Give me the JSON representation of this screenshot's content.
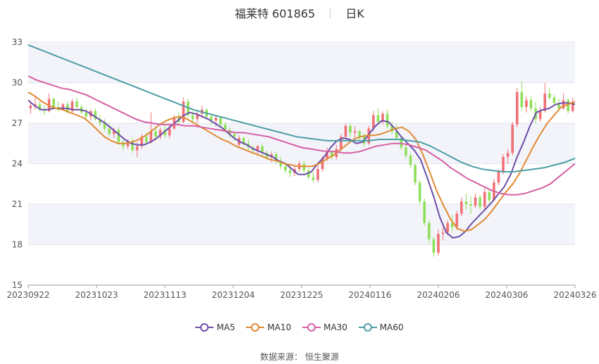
{
  "title": "福莱特 601865",
  "period": "日K",
  "source": "数据来源：   恒生聚源",
  "chart_data": {
    "type": "candlestick",
    "ylim": [
      15,
      33
    ],
    "yticks": [
      15,
      18,
      21,
      24,
      27,
      30,
      33
    ],
    "xticks": [
      "20230922",
      "20231023",
      "20231113",
      "20231204",
      "20231225",
      "20240116",
      "20240206",
      "20240306",
      "20240326"
    ],
    "up_color": "#f07178",
    "down_color": "#8fe05a",
    "candles_ohlc": [
      [
        28.1,
        28.5,
        27.7,
        28.3
      ],
      [
        28.3,
        28.9,
        28.0,
        28.4
      ],
      [
        28.4,
        28.6,
        27.9,
        28.0
      ],
      [
        28.0,
        28.3,
        27.6,
        27.9
      ],
      [
        27.9,
        29.2,
        27.8,
        28.8
      ],
      [
        28.8,
        28.9,
        28.1,
        28.2
      ],
      [
        28.2,
        28.6,
        27.8,
        28.0
      ],
      [
        28.0,
        28.5,
        27.9,
        28.4
      ],
      [
        28.4,
        28.6,
        27.7,
        27.9
      ],
      [
        27.9,
        28.8,
        27.8,
        28.6
      ],
      [
        28.6,
        28.9,
        28.1,
        28.2
      ],
      [
        28.2,
        28.4,
        27.7,
        27.8
      ],
      [
        27.8,
        28.1,
        27.3,
        27.5
      ],
      [
        27.5,
        28.0,
        27.2,
        27.9
      ],
      [
        27.9,
        28.1,
        27.2,
        27.3
      ],
      [
        27.3,
        27.6,
        26.8,
        27.0
      ],
      [
        27.0,
        27.3,
        26.4,
        26.6
      ],
      [
        26.6,
        26.9,
        26.0,
        26.2
      ],
      [
        26.2,
        26.7,
        25.9,
        26.5
      ],
      [
        26.5,
        26.7,
        25.4,
        25.6
      ],
      [
        25.6,
        25.8,
        25.0,
        25.3
      ],
      [
        25.3,
        25.8,
        25.1,
        25.7
      ],
      [
        25.7,
        25.9,
        24.8,
        25.0
      ],
      [
        25.0,
        25.6,
        24.5,
        25.3
      ],
      [
        25.3,
        26.2,
        25.1,
        26.0
      ],
      [
        26.0,
        26.3,
        25.4,
        25.6
      ],
      [
        25.6,
        27.8,
        25.5,
        26.4
      ],
      [
        26.4,
        26.6,
        25.7,
        26.0
      ],
      [
        26.0,
        26.7,
        25.8,
        26.5
      ],
      [
        26.5,
        26.9,
        25.9,
        26.1
      ],
      [
        26.1,
        26.9,
        25.9,
        26.6
      ],
      [
        26.6,
        27.6,
        26.5,
        27.4
      ],
      [
        27.4,
        27.8,
        26.9,
        27.1
      ],
      [
        27.1,
        28.9,
        27.0,
        28.6
      ],
      [
        28.6,
        28.8,
        27.4,
        27.6
      ],
      [
        27.6,
        27.9,
        27.1,
        27.3
      ],
      [
        27.3,
        27.9,
        27.0,
        27.7
      ],
      [
        27.7,
        28.3,
        27.4,
        28.0
      ],
      [
        28.0,
        28.1,
        27.3,
        27.5
      ],
      [
        27.5,
        27.7,
        26.9,
        27.2
      ],
      [
        27.2,
        27.6,
        26.8,
        27.4
      ],
      [
        27.4,
        27.5,
        26.7,
        26.9
      ],
      [
        26.9,
        27.1,
        26.3,
        26.5
      ],
      [
        26.5,
        26.7,
        25.9,
        26.2
      ],
      [
        26.2,
        26.4,
        25.7,
        26.0
      ],
      [
        25.4,
        26.1,
        25.2,
        25.9
      ],
      [
        25.9,
        26.0,
        25.3,
        25.5
      ],
      [
        25.5,
        25.8,
        24.9,
        25.2
      ],
      [
        25.2,
        25.4,
        24.7,
        25.0
      ],
      [
        25.0,
        25.4,
        24.6,
        25.3
      ],
      [
        25.3,
        25.5,
        24.6,
        24.8
      ],
      [
        24.8,
        25.0,
        24.3,
        24.5
      ],
      [
        24.5,
        24.9,
        24.1,
        24.7
      ],
      [
        24.7,
        24.9,
        24.0,
        24.2
      ],
      [
        24.2,
        24.5,
        23.6,
        23.8
      ],
      [
        23.8,
        24.1,
        23.3,
        23.5
      ],
      [
        23.5,
        23.9,
        23.0,
        23.3
      ],
      [
        23.3,
        23.8,
        23.1,
        23.6
      ],
      [
        23.6,
        24.2,
        23.4,
        24.0
      ],
      [
        24.0,
        24.2,
        23.3,
        23.5
      ],
      [
        23.5,
        23.7,
        22.8,
        23.0
      ],
      [
        23.0,
        23.4,
        22.6,
        22.8
      ],
      [
        22.8,
        23.9,
        22.6,
        23.6
      ],
      [
        23.6,
        24.6,
        23.4,
        24.4
      ],
      [
        24.4,
        25.2,
        24.2,
        24.9
      ],
      [
        24.9,
        25.0,
        24.3,
        24.5
      ],
      [
        24.5,
        25.4,
        24.3,
        25.1
      ],
      [
        25.1,
        26.2,
        24.9,
        26.0
      ],
      [
        26.0,
        27.0,
        25.8,
        26.8
      ],
      [
        26.8,
        27.0,
        26.0,
        26.3
      ],
      [
        26.3,
        26.8,
        25.8,
        26.4
      ],
      [
        26.4,
        26.5,
        25.7,
        26.0
      ],
      [
        26.0,
        26.3,
        25.3,
        25.5
      ],
      [
        25.5,
        26.8,
        25.4,
        26.6
      ],
      [
        26.6,
        27.9,
        26.4,
        27.6
      ],
      [
        27.6,
        28.1,
        26.9,
        27.1
      ],
      [
        27.1,
        27.9,
        26.9,
        27.7
      ],
      [
        27.7,
        28.0,
        26.6,
        26.8
      ],
      [
        26.8,
        27.1,
        26.2,
        26.4
      ],
      [
        26.4,
        26.9,
        25.7,
        25.9
      ],
      [
        25.9,
        26.0,
        25.0,
        25.2
      ],
      [
        25.2,
        25.4,
        24.4,
        24.6
      ],
      [
        24.6,
        24.8,
        23.7,
        23.9
      ],
      [
        23.9,
        24.0,
        22.4,
        22.6
      ],
      [
        22.6,
        22.8,
        21.0,
        21.2
      ],
      [
        21.2,
        21.4,
        19.4,
        19.6
      ],
      [
        19.6,
        19.8,
        18.1,
        18.4
      ],
      [
        18.4,
        18.6,
        17.1,
        17.4
      ],
      [
        17.4,
        19.1,
        17.2,
        18.8
      ],
      [
        18.8,
        19.3,
        18.3,
        18.9
      ],
      [
        18.9,
        19.8,
        18.7,
        19.6
      ],
      [
        19.6,
        20.2,
        19.0,
        19.3
      ],
      [
        19.3,
        20.5,
        19.1,
        20.3
      ],
      [
        20.3,
        21.5,
        20.1,
        21.2
      ],
      [
        21.2,
        21.8,
        20.6,
        21.0
      ],
      [
        21.0,
        21.6,
        20.3,
        20.9
      ],
      [
        20.9,
        21.8,
        20.7,
        21.5
      ],
      [
        21.5,
        21.7,
        20.6,
        20.8
      ],
      [
        20.8,
        22.2,
        20.6,
        21.9
      ],
      [
        21.9,
        22.1,
        21.0,
        21.3
      ],
      [
        21.3,
        22.9,
        21.2,
        22.6
      ],
      [
        22.6,
        23.6,
        22.4,
        23.4
      ],
      [
        23.4,
        24.7,
        23.2,
        24.5
      ],
      [
        24.5,
        25.1,
        24.0,
        24.8
      ],
      [
        24.8,
        27.1,
        24.6,
        26.9
      ],
      [
        26.9,
        29.6,
        26.7,
        29.3
      ],
      [
        29.3,
        30.1,
        28.0,
        28.2
      ],
      [
        28.2,
        29.0,
        27.8,
        28.7
      ],
      [
        28.7,
        29.0,
        27.9,
        28.1
      ],
      [
        28.1,
        28.6,
        27.0,
        27.3
      ],
      [
        27.3,
        28.2,
        27.1,
        27.9
      ],
      [
        27.9,
        30.0,
        27.8,
        29.2
      ],
      [
        29.2,
        29.6,
        28.7,
        28.9
      ],
      [
        28.9,
        29.1,
        28.3,
        28.5
      ],
      [
        28.5,
        28.8,
        27.9,
        28.1
      ],
      [
        28.1,
        29.2,
        28.0,
        28.7
      ],
      [
        28.7,
        28.9,
        27.7,
        27.9
      ],
      [
        27.9,
        28.9,
        27.8,
        28.6
      ]
    ],
    "series": [
      {
        "name": "MA5",
        "color": "#6d4fa8",
        "values": [
          28.7,
          28.3,
          28.0,
          28.0,
          28.1,
          28.1,
          28.1,
          28.0,
          28.0,
          27.9,
          27.6,
          27.3,
          27.0,
          26.6,
          26.2,
          25.8,
          25.5,
          25.4,
          25.4,
          25.6,
          25.9,
          26.3,
          26.7,
          27.1,
          27.5,
          27.8,
          27.7,
          27.5,
          27.3,
          27.0,
          26.7,
          26.3,
          25.9,
          25.6,
          25.4,
          25.1,
          24.9,
          24.7,
          24.5,
          24.2,
          24.0,
          23.6,
          23.2,
          23.2,
          23.4,
          24.0,
          24.5,
          25.2,
          25.7,
          25.9,
          25.8,
          25.5,
          25.6,
          26.2,
          26.8,
          27.2,
          27.1,
          26.6,
          26.0,
          25.5,
          25.0,
          24.3,
          23.0,
          21.6,
          20.0,
          18.9,
          18.5,
          18.6,
          19.0,
          19.6,
          20.1,
          20.6,
          21.1,
          21.7,
          22.3,
          23.2,
          24.5,
          25.6,
          26.8,
          27.8,
          28.0,
          28.1,
          28.4,
          28.5,
          28.5,
          28.4
        ]
      },
      {
        "name": "MA10",
        "color": "#e08a33",
        "values": [
          29.3,
          29.0,
          28.6,
          28.3,
          28.1,
          28.0,
          27.8,
          27.6,
          27.4,
          27.0,
          26.5,
          26.0,
          25.7,
          25.5,
          25.5,
          25.6,
          25.8,
          26.1,
          26.5,
          26.9,
          27.2,
          27.4,
          27.5,
          27.3,
          27.0,
          26.7,
          26.4,
          26.1,
          25.8,
          25.6,
          25.3,
          25.1,
          24.9,
          24.7,
          24.5,
          24.3,
          24.2,
          24.0,
          23.9,
          23.8,
          23.8,
          23.8,
          24.0,
          24.3,
          24.6,
          25.0,
          25.4,
          25.8,
          26.0,
          26.1,
          26.1,
          26.2,
          26.4,
          26.6,
          26.7,
          26.4,
          25.8,
          24.7,
          23.4,
          22.0,
          20.9,
          19.9,
          19.2,
          19.0,
          19.1,
          19.5,
          19.9,
          20.5,
          21.2,
          21.9,
          22.5,
          23.3,
          24.3,
          25.3,
          26.2,
          27.0,
          27.6,
          28.2,
          28.4,
          28.6
        ]
      },
      {
        "name": "MA30",
        "color": "#d65fa4",
        "values": [
          30.5,
          30.2,
          30.0,
          29.8,
          29.6,
          29.5,
          29.3,
          29.1,
          28.8,
          28.5,
          28.2,
          27.9,
          27.6,
          27.3,
          27.1,
          27.0,
          26.9,
          26.9,
          26.9,
          26.8,
          26.8,
          26.7,
          26.6,
          26.5,
          26.4,
          26.3,
          26.3,
          26.2,
          26.1,
          26.0,
          25.8,
          25.6,
          25.4,
          25.2,
          25.1,
          25.0,
          24.9,
          24.9,
          24.8,
          24.8,
          24.9,
          25.1,
          25.3,
          25.4,
          25.5,
          25.5,
          25.4,
          25.2,
          25.0,
          24.6,
          24.2,
          23.7,
          23.3,
          22.9,
          22.6,
          22.3,
          22.0,
          21.8,
          21.7,
          21.7,
          21.8,
          22.0,
          22.2,
          22.5,
          23.0,
          23.5,
          24.0
        ]
      },
      {
        "name": "MA60",
        "color": "#4c9ea6",
        "values": [
          32.8,
          32.5,
          32.2,
          31.9,
          31.6,
          31.3,
          31.0,
          30.7,
          30.4,
          30.1,
          29.8,
          29.5,
          29.2,
          28.9,
          28.6,
          28.3,
          28.0,
          27.8,
          27.6,
          27.4,
          27.2,
          27.0,
          26.8,
          26.6,
          26.4,
          26.2,
          26.0,
          25.9,
          25.8,
          25.7,
          25.7,
          25.7,
          25.7,
          25.7,
          25.8,
          25.8,
          25.8,
          25.7,
          25.6,
          25.3,
          24.9,
          24.5,
          24.1,
          23.8,
          23.6,
          23.5,
          23.4,
          23.4,
          23.5,
          23.6,
          23.7,
          23.9,
          24.1,
          24.4
        ]
      }
    ]
  }
}
